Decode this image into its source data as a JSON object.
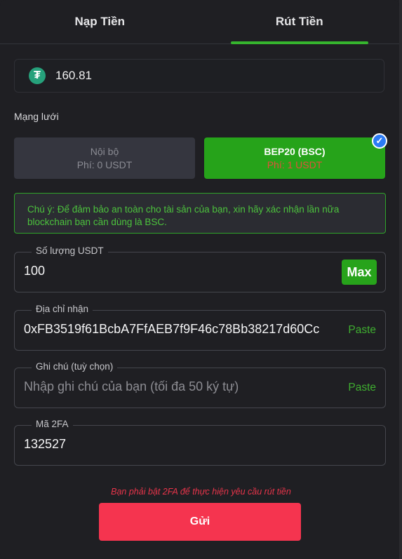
{
  "tabs": [
    {
      "label": "Nạp Tiền",
      "active": false
    },
    {
      "label": "Rút Tiền",
      "active": true
    }
  ],
  "balance": {
    "icon": "tether-icon",
    "value": "160.81"
  },
  "network": {
    "label": "Mạng lưới",
    "options": [
      {
        "name": "Nội bộ",
        "fee": "Phí: 0 USDT",
        "selected": false
      },
      {
        "name": "BEP20 (BSC)",
        "fee": "Phí: 1 USDT",
        "selected": true
      }
    ]
  },
  "note": "Chú ý: Để đảm bảo an toàn cho tài sản của bạn, xin hãy xác nhận lần nữa blockchain bạn cần dùng là BSC.",
  "amount": {
    "label": "Số lượng USDT",
    "value": "100",
    "max_label": "Max"
  },
  "address": {
    "label": "Địa chỉ nhận",
    "value": "0xFB3519f61BcbA7FfAEB7f9F46c78Bb38217d60Cc",
    "paste_label": "Paste"
  },
  "memo": {
    "label": "Ghi chú (tuỳ chọn)",
    "placeholder": "Nhập ghi chú của bạn (tối đa 50 ký tự)",
    "paste_label": "Paste"
  },
  "twofa": {
    "label": "Mã 2FA",
    "value": "132527"
  },
  "warning": "Bạn phải bật 2FA để thực hiện yêu cầu rút tiền",
  "submit_label": "Gửi",
  "colors": {
    "accent_green": "#26a31a",
    "submit_red": "#f5344f",
    "warning_red": "#e8344a",
    "check_blue": "#2b7bf5"
  }
}
